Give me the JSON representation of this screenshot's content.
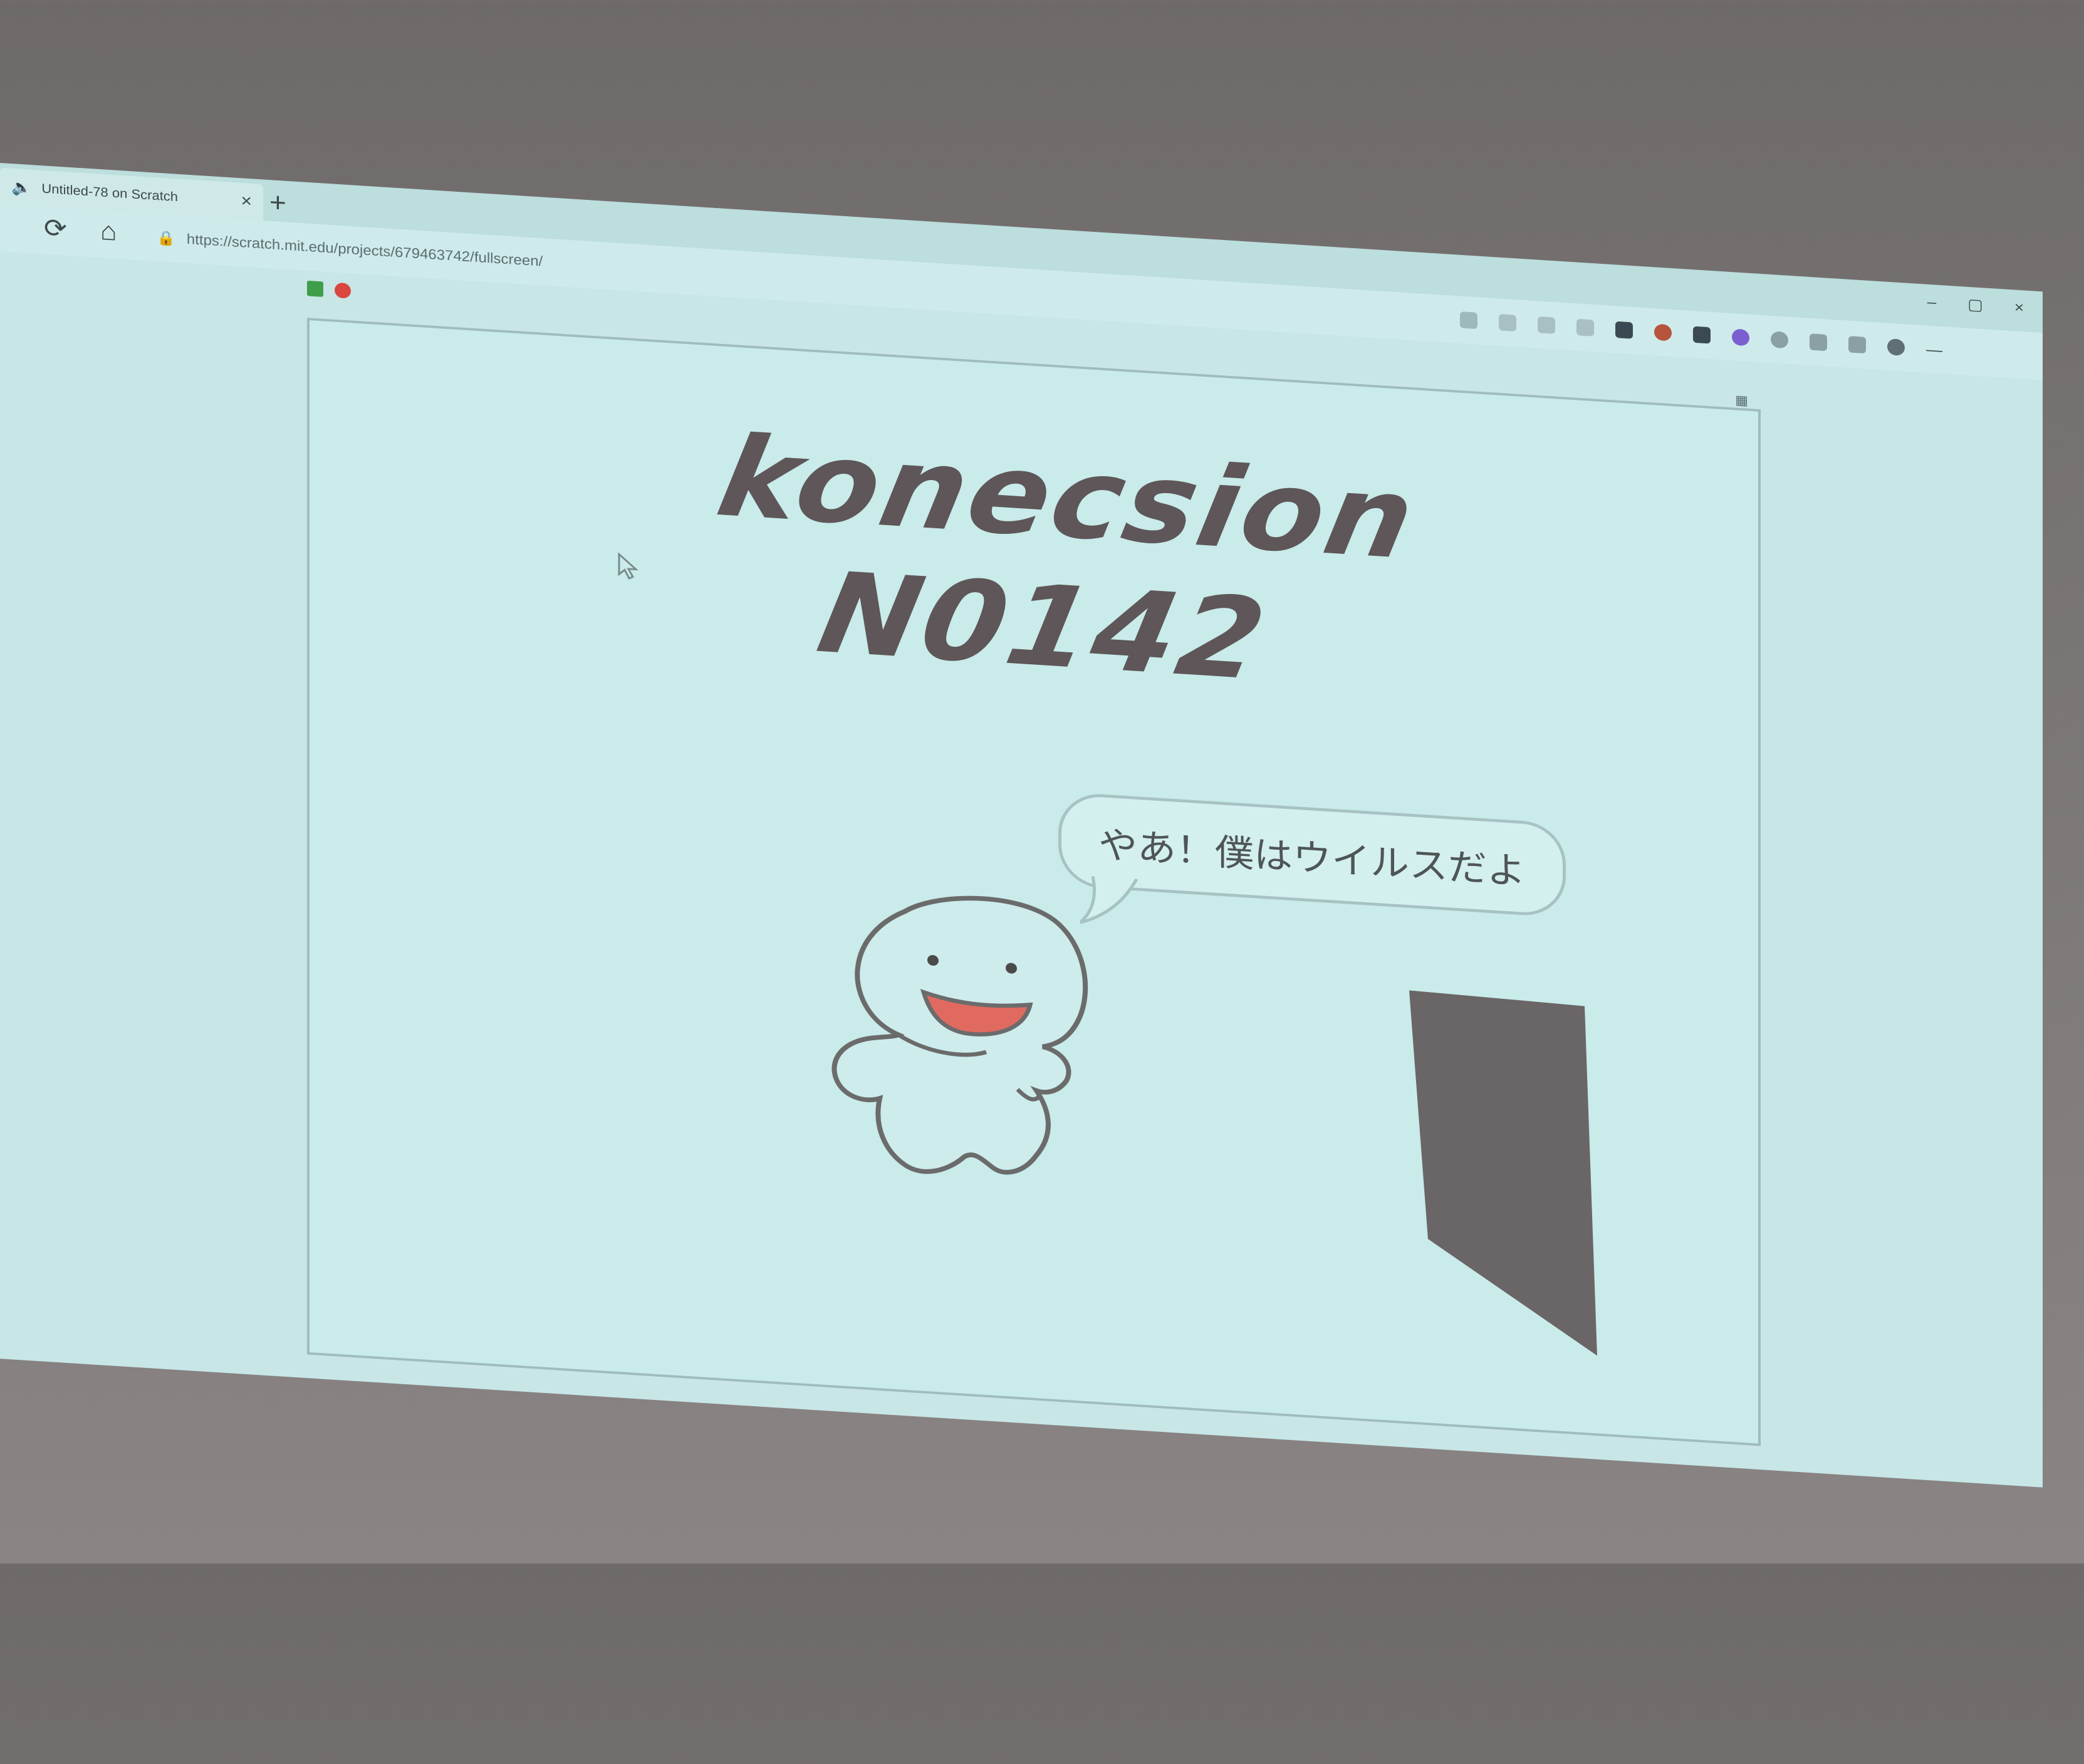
{
  "browser": {
    "tab_title": "Untitled-78 on Scratch",
    "tab_close": "×",
    "new_tab": "+",
    "url": "https://scratch.mit.edu/projects/679463742/fullscreen/",
    "window_controls": [
      "–",
      "▢",
      "×"
    ]
  },
  "stage": {
    "title": "konecsion N0142",
    "speech_bubble": "やあ！僕はウイルスだよ"
  },
  "colors": {
    "background": "#c9ebea",
    "title_text": "#5e5658",
    "virus_outline": "#6b6b6b",
    "mouth": "#e06a60",
    "door": "#6a6566"
  },
  "icons": [
    "speaker-icon",
    "reload-icon",
    "home-icon",
    "lock-icon",
    "green-flag-icon",
    "stop-icon",
    "fullscreen-icon"
  ]
}
